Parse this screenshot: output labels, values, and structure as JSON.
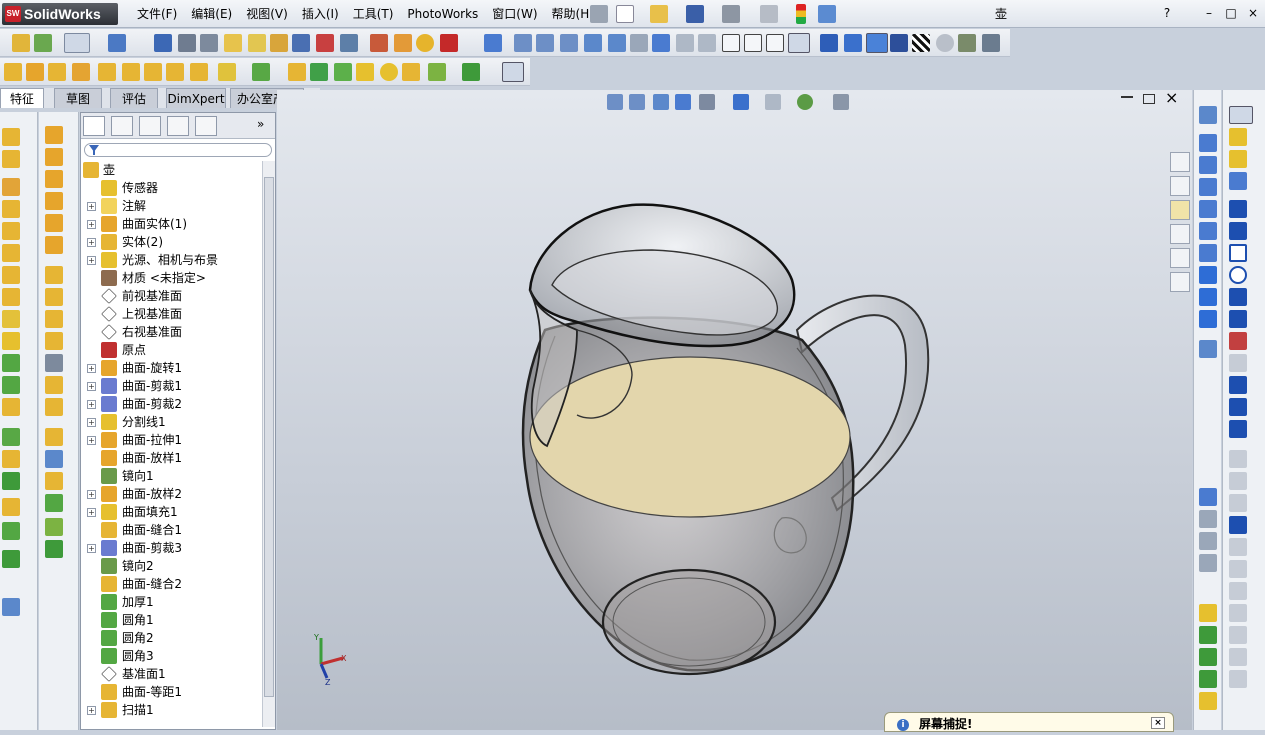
{
  "app": {
    "name": "SolidWorks",
    "logo_mark": "SW",
    "document_title": "壶"
  },
  "menu": [
    "文件(F)",
    "编辑(E)",
    "视图(V)",
    "插入(I)",
    "工具(T)",
    "PhotoWorks",
    "窗口(W)",
    "帮助(H)"
  ],
  "window_controls": {
    "help": "?",
    "minimize": "–",
    "restore": "□",
    "close": "×"
  },
  "command_tabs": [
    {
      "label": "特征",
      "active": true
    },
    {
      "label": "草图",
      "active": false
    },
    {
      "label": "评估",
      "active": false
    },
    {
      "label": "DimXpert",
      "active": false
    },
    {
      "label": "办公室产品",
      "active": false
    }
  ],
  "feature_tree": {
    "expand_label": "»",
    "filter_icon": "filter-icon",
    "root": {
      "label": "壶",
      "icon": "part-icon"
    },
    "items": [
      {
        "label": "传感器",
        "expand": false,
        "icon": "sensor-icon"
      },
      {
        "label": "注解",
        "expand": true,
        "icon": "annotation-icon"
      },
      {
        "label": "曲面实体(1)",
        "expand": true,
        "icon": "surface-body-icon"
      },
      {
        "label": "实体(2)",
        "expand": true,
        "icon": "solid-body-icon"
      },
      {
        "label": "光源、相机与布景",
        "expand": true,
        "icon": "lights-icon"
      },
      {
        "label": "材质 <未指定>",
        "expand": false,
        "icon": "material-icon"
      },
      {
        "label": "前视基准面",
        "expand": false,
        "icon": "plane-icon"
      },
      {
        "label": "上视基准面",
        "expand": false,
        "icon": "plane-icon"
      },
      {
        "label": "右视基准面",
        "expand": false,
        "icon": "plane-icon"
      },
      {
        "label": "原点",
        "expand": false,
        "icon": "origin-icon"
      },
      {
        "label": "曲面-旋转1",
        "expand": true,
        "icon": "surface-revolve-icon"
      },
      {
        "label": "曲面-剪裁1",
        "expand": true,
        "icon": "surface-trim-icon"
      },
      {
        "label": "曲面-剪裁2",
        "expand": true,
        "icon": "surface-trim-icon"
      },
      {
        "label": "分割线1",
        "expand": true,
        "icon": "split-line-icon"
      },
      {
        "label": "曲面-拉伸1",
        "expand": true,
        "icon": "surface-extrude-icon"
      },
      {
        "label": "曲面-放样1",
        "expand": false,
        "icon": "surface-loft-icon"
      },
      {
        "label": "镜向1",
        "expand": false,
        "icon": "mirror-icon"
      },
      {
        "label": "曲面-放样2",
        "expand": true,
        "icon": "surface-loft-icon"
      },
      {
        "label": "曲面填充1",
        "expand": true,
        "icon": "surface-fill-icon"
      },
      {
        "label": "曲面-缝合1",
        "expand": false,
        "icon": "surface-knit-icon"
      },
      {
        "label": "曲面-剪裁3",
        "expand": true,
        "icon": "surface-trim-icon"
      },
      {
        "label": "镜向2",
        "expand": false,
        "icon": "mirror-icon"
      },
      {
        "label": "曲面-缝合2",
        "expand": false,
        "icon": "surface-knit-icon"
      },
      {
        "label": "加厚1",
        "expand": false,
        "icon": "thicken-icon"
      },
      {
        "label": "圆角1",
        "expand": false,
        "icon": "fillet-icon"
      },
      {
        "label": "圆角2",
        "expand": false,
        "icon": "fillet-icon"
      },
      {
        "label": "圆角3",
        "expand": false,
        "icon": "fillet-icon"
      },
      {
        "label": "基准面1",
        "expand": false,
        "icon": "plane-icon"
      },
      {
        "label": "曲面-等距1",
        "expand": false,
        "icon": "surface-offset-icon"
      },
      {
        "label": "扫描1",
        "expand": true,
        "icon": "sweep-icon"
      }
    ]
  },
  "triad": {
    "x": "X",
    "y": "Y",
    "z": "Z"
  },
  "popup": {
    "title": "屏幕捕捉!",
    "info_icon": "i",
    "close": "×"
  },
  "colors": {
    "accent_yellow": "#f2c400",
    "liquid": "#e3d6ac",
    "brand_red": "#c8202a"
  }
}
